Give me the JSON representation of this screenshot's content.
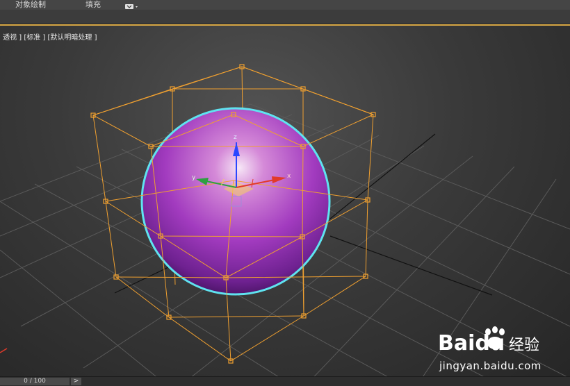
{
  "menu": {
    "object_paint": "对象绘制",
    "fill": "填充"
  },
  "viewport": {
    "label_view": "[ 透视 ]",
    "label_standard": "[标准 ]",
    "label_shading": "[默认明暗处理 ]",
    "active_border_color": "#d9a845"
  },
  "scene": {
    "object": "sphere",
    "sphere_color": "#a23bbf",
    "selection_outline_color": "#5fe3f0",
    "lattice_color": "#f0a030",
    "axis_labels": {
      "x": "x",
      "y": "y",
      "z": "z"
    }
  },
  "timeline": {
    "frame_readout": "0 / 100",
    "next_button": ">"
  },
  "watermark": {
    "brand": "Baidu",
    "sub": "经验",
    "url": "jingyan.baidu.com"
  }
}
